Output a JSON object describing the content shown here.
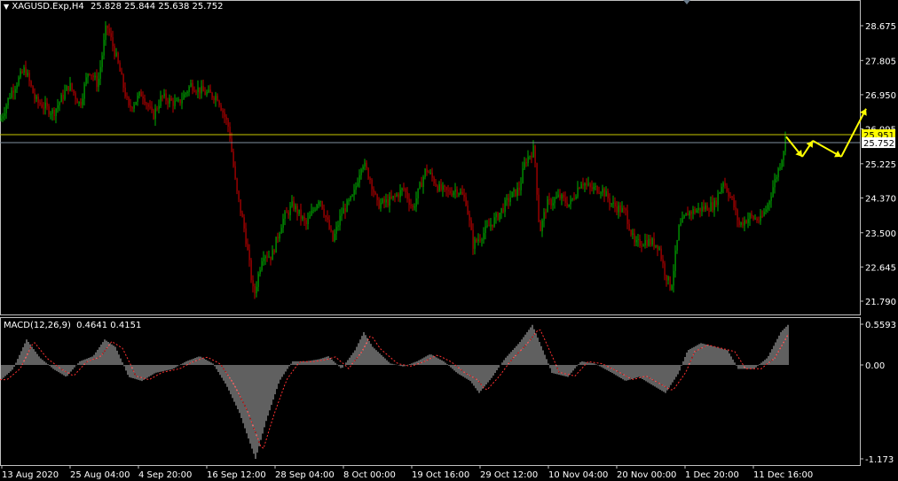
{
  "colors": {
    "background": "#000000",
    "frame": "#c0c0c0",
    "text": "#ffffff",
    "bull_candle": "#00b000",
    "bear_candle": "#c00000",
    "level_line": "#c8c800",
    "bid_line": "#7f8f9f",
    "forecast_arrow": "#ffff00",
    "price_label_bg": "#ffff00",
    "macd_hist": "#c0c0c0",
    "macd_signal": "#ff3030"
  },
  "header": {
    "symbol": "XAGUSD.Exp,H4",
    "ohlc": "25.828 25.844 25.638 25.752",
    "marker_icon": "triangle-down-icon"
  },
  "indicator": {
    "title": "MACD(12,26,9)",
    "values": "0.4641 0.4151"
  },
  "price_axis": {
    "ticks": [
      "28.675",
      "27.805",
      "26.950",
      "26.095",
      "25.225",
      "24.370",
      "23.500",
      "22.645",
      "21.790"
    ],
    "tick_values": [
      28.675,
      27.805,
      26.95,
      26.095,
      25.225,
      24.37,
      23.5,
      22.645,
      21.79
    ],
    "current_price": "25.752",
    "level_price": "25.951"
  },
  "macd_axis": {
    "ticks": [
      "0.5593",
      "0.00",
      "-1.173"
    ]
  },
  "time_axis": {
    "labels": [
      "13 Aug 2020",
      "25 Aug 04:00",
      "4 Sep 20:00",
      "16 Sep 12:00",
      "28 Sep 04:00",
      "8 Oct 00:00",
      "19 Oct 16:00",
      "29 Oct 12:00",
      "10 Nov 04:00",
      "20 Nov 00:00",
      "1 Dec 20:00",
      "11 Dec 16:00"
    ]
  },
  "chart_data": [
    {
      "type": "candlestick",
      "symbol": "XAGUSD.Exp",
      "timeframe": "H4",
      "ylim": [
        21.79,
        28.675
      ],
      "path_points": [
        [
          0,
          26.3
        ],
        [
          12,
          27.0
        ],
        [
          28,
          27.6
        ],
        [
          40,
          26.8
        ],
        [
          60,
          26.5
        ],
        [
          78,
          27.2
        ],
        [
          90,
          26.7
        ],
        [
          100,
          27.6
        ],
        [
          110,
          27.2
        ],
        [
          120,
          28.7
        ],
        [
          132,
          27.8
        ],
        [
          145,
          26.6
        ],
        [
          160,
          27.0
        ],
        [
          172,
          26.4
        ],
        [
          182,
          26.9
        ],
        [
          200,
          26.7
        ],
        [
          215,
          27.2
        ],
        [
          230,
          27.0
        ],
        [
          245,
          26.9
        ],
        [
          258,
          26.1
        ],
        [
          266,
          24.6
        ],
        [
          276,
          23.5
        ],
        [
          286,
          21.9
        ],
        [
          296,
          23.0
        ],
        [
          306,
          22.9
        ],
        [
          318,
          23.8
        ],
        [
          330,
          24.2
        ],
        [
          345,
          23.7
        ],
        [
          360,
          24.4
        ],
        [
          375,
          23.3
        ],
        [
          385,
          24.0
        ],
        [
          398,
          24.4
        ],
        [
          408,
          25.3
        ],
        [
          418,
          24.8
        ],
        [
          425,
          24.2
        ],
        [
          440,
          24.3
        ],
        [
          455,
          24.6
        ],
        [
          465,
          24.1
        ],
        [
          480,
          25.1
        ],
        [
          495,
          24.6
        ],
        [
          505,
          24.5
        ],
        [
          515,
          24.6
        ],
        [
          525,
          24.3
        ],
        [
          533,
          23.2
        ],
        [
          545,
          23.5
        ],
        [
          560,
          23.9
        ],
        [
          575,
          24.4
        ],
        [
          585,
          24.6
        ],
        [
          592,
          25.3
        ],
        [
          602,
          25.6
        ],
        [
          608,
          23.5
        ],
        [
          616,
          24.2
        ],
        [
          630,
          24.4
        ],
        [
          642,
          24.2
        ],
        [
          655,
          24.8
        ],
        [
          665,
          24.6
        ],
        [
          678,
          24.6
        ],
        [
          690,
          24.2
        ],
        [
          705,
          24.0
        ],
        [
          715,
          23.2
        ],
        [
          728,
          23.3
        ],
        [
          742,
          23.2
        ],
        [
          748,
          22.6
        ],
        [
          756,
          22.1
        ],
        [
          765,
          23.6
        ],
        [
          775,
          24.0
        ],
        [
          790,
          24.1
        ],
        [
          805,
          24.2
        ],
        [
          815,
          24.8
        ],
        [
          825,
          24.3
        ],
        [
          833,
          23.7
        ],
        [
          845,
          23.9
        ],
        [
          857,
          23.8
        ],
        [
          865,
          24.2
        ],
        [
          873,
          24.8
        ],
        [
          880,
          25.3
        ],
        [
          886,
          25.9
        ]
      ],
      "current_price": 25.752,
      "horizontal_level": 25.951,
      "forecast_path": [
        [
          886,
          25.9
        ],
        [
          904,
          25.4
        ],
        [
          916,
          25.8
        ],
        [
          948,
          25.4
        ],
        [
          976,
          26.6
        ]
      ]
    },
    {
      "type": "bar",
      "indicator": "MACD(12,26,9)",
      "macd": 0.4641,
      "signal": 0.4151,
      "ylim": [
        -1.173,
        0.5593
      ],
      "path_points": [
        [
          0,
          -0.2
        ],
        [
          15,
          -0.05
        ],
        [
          30,
          0.35
        ],
        [
          45,
          0.1
        ],
        [
          60,
          -0.05
        ],
        [
          75,
          -0.15
        ],
        [
          90,
          0.05
        ],
        [
          105,
          0.12
        ],
        [
          118,
          0.35
        ],
        [
          130,
          0.25
        ],
        [
          145,
          -0.15
        ],
        [
          160,
          -0.2
        ],
        [
          175,
          -0.1
        ],
        [
          195,
          -0.05
        ],
        [
          210,
          0.05
        ],
        [
          225,
          0.12
        ],
        [
          240,
          0.02
        ],
        [
          255,
          -0.25
        ],
        [
          270,
          -0.6
        ],
        [
          288,
          -1.173
        ],
        [
          300,
          -0.7
        ],
        [
          315,
          -0.2
        ],
        [
          330,
          0.05
        ],
        [
          345,
          0.05
        ],
        [
          360,
          0.08
        ],
        [
          370,
          0.12
        ],
        [
          385,
          -0.05
        ],
        [
          400,
          0.2
        ],
        [
          410,
          0.45
        ],
        [
          420,
          0.25
        ],
        [
          440,
          0.02
        ],
        [
          455,
          -0.02
        ],
        [
          470,
          0.05
        ],
        [
          485,
          0.15
        ],
        [
          500,
          0.05
        ],
        [
          515,
          -0.1
        ],
        [
          530,
          -0.2
        ],
        [
          540,
          -0.35
        ],
        [
          555,
          -0.15
        ],
        [
          570,
          0.1
        ],
        [
          585,
          0.3
        ],
        [
          600,
          0.55
        ],
        [
          612,
          0.2
        ],
        [
          622,
          -0.1
        ],
        [
          640,
          -0.15
        ],
        [
          655,
          0.05
        ],
        [
          670,
          0.02
        ],
        [
          690,
          -0.1
        ],
        [
          705,
          -0.2
        ],
        [
          720,
          -0.15
        ],
        [
          735,
          -0.25
        ],
        [
          750,
          -0.35
        ],
        [
          765,
          -0.1
        ],
        [
          775,
          0.2
        ],
        [
          790,
          0.3
        ],
        [
          805,
          0.25
        ],
        [
          820,
          0.2
        ],
        [
          832,
          -0.05
        ],
        [
          850,
          -0.05
        ],
        [
          865,
          0.1
        ],
        [
          880,
          0.45
        ],
        [
          888,
          0.55
        ]
      ]
    }
  ]
}
